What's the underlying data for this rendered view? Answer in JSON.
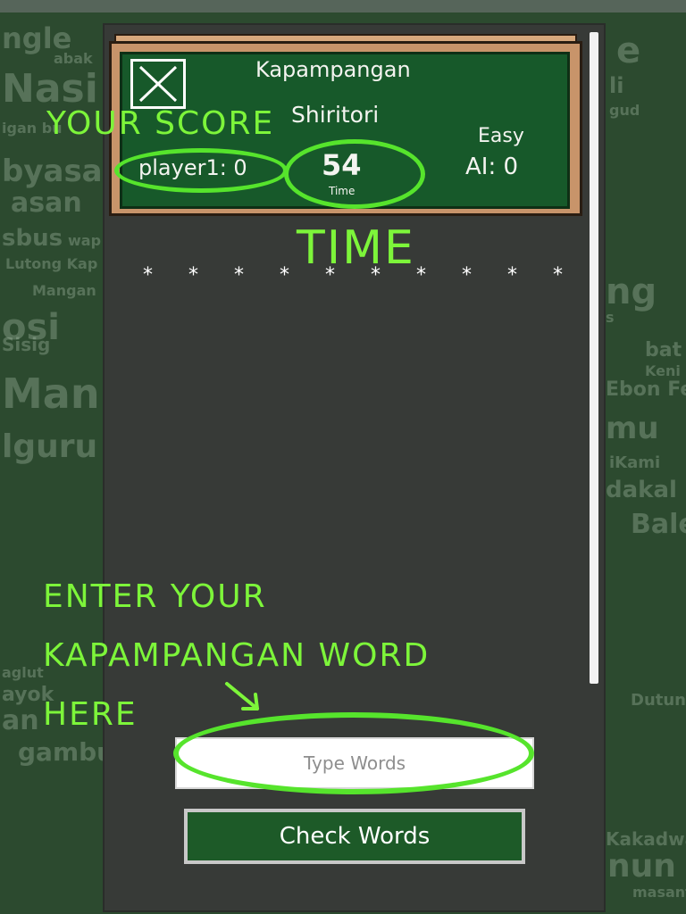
{
  "background_words": [
    "ngle",
    "abak",
    "Nasi",
    "igan bu",
    "byasa",
    "asan",
    "sbus",
    "wap",
    "Lutong Kap",
    "Mangan",
    "osi",
    "Sisig",
    "Man",
    "lguru",
    "aglut",
    "ayok",
    "an",
    "gambu",
    "e",
    "li",
    "gud",
    "ng",
    "s",
    "bat",
    "Keni",
    "Ebon Fe",
    "mu",
    "iKami",
    "dakal",
    "Bale",
    "Dutung",
    "Kakadwa",
    "nun",
    "masant"
  ],
  "header": {
    "close_icon": "close-x-icon",
    "title_line1": "Kapampangan",
    "title_line2": "Shiritori",
    "difficulty": "Easy",
    "player_score": "player1: 0",
    "timer_value": "54",
    "timer_label": "Time",
    "ai_score": "AI: 0"
  },
  "annotations": {
    "your_score": "YOUR SCORE",
    "time": "TIME",
    "enter_line1": "ENTER YOUR",
    "enter_line2": "KAPAMPANGAN WORD",
    "enter_line3": "HERE"
  },
  "word_slots": [
    "*",
    "*",
    "*",
    "*",
    "*",
    "*",
    "*",
    "*",
    "*",
    "*"
  ],
  "input": {
    "placeholder": "Type Words",
    "value": ""
  },
  "check_button": {
    "label": "Check Words"
  },
  "colors": {
    "chalkboard": "#17592a",
    "annotation_green": "#7df53a",
    "panel": "#373a37",
    "frame_wood": "#c8946a"
  }
}
